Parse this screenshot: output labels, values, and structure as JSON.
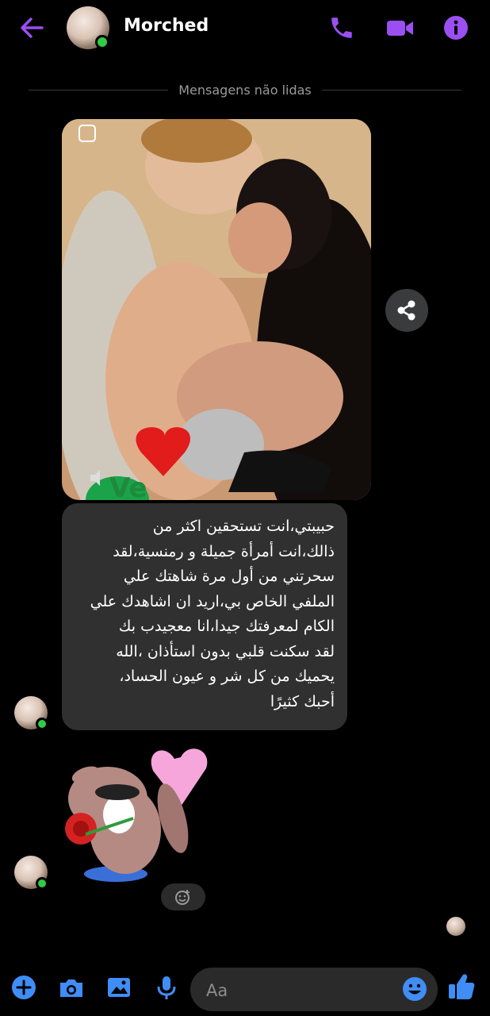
{
  "header": {
    "contact_name": "Morched",
    "online": true
  },
  "divider": {
    "label": "Mensagens não lidas"
  },
  "messages": {
    "image_sticker_text": "Ve",
    "text_lines": [
      "حبيبتي،انت تستحقين اكثر من",
      "ذالك،انت أمرأة جميلة و رمنسية،لقد",
      "سحرتني من أول مرة شاهتك علي",
      "الملفي الخاص بي،اريد ان اشاهدك علي",
      "الكام لمعرفتك جيدا،انا معجيدب بك",
      "لقد سكنت قلبي بدون استأذان ،الله",
      "يحميك من كل شر و عيون الحساد،",
      "أحبك كثيرًا"
    ]
  },
  "composer": {
    "placeholder": "Aa"
  },
  "icons": {
    "back": "back-arrow-icon",
    "call": "phone-icon",
    "video": "video-camera-icon",
    "info": "info-icon",
    "share": "share-icon",
    "add": "plus-icon",
    "camera": "camera-icon",
    "gallery": "image-icon",
    "mic": "microphone-icon",
    "emoji": "emoji-icon",
    "like": "thumbs-up-icon",
    "react": "add-reaction-icon"
  },
  "colors": {
    "accent_purple": "#9b4ff1",
    "accent_blue": "#3f8df5",
    "bubble": "#303030",
    "online": "#31cc46"
  }
}
